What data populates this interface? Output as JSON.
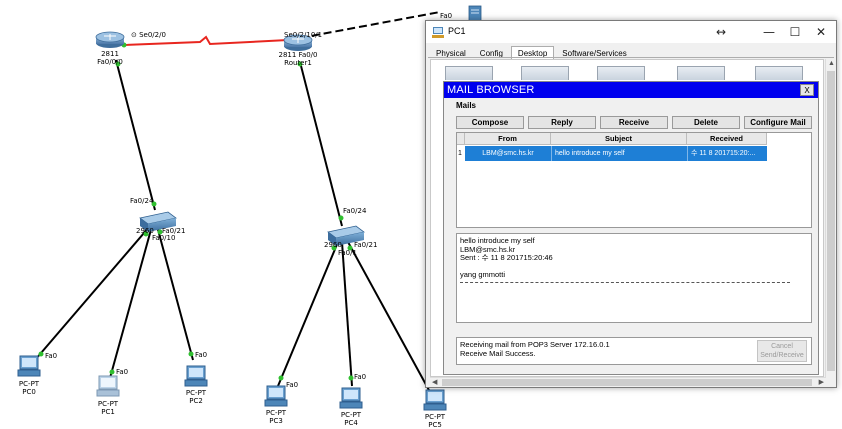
{
  "topology": {
    "router_2811": {
      "model": "2811",
      "port_label": "Fa0/0",
      "serial_label": "Se0/2/0"
    },
    "router1": {
      "model": "2811",
      "name": "Router1",
      "serial_label": "Se0/2/1",
      "port_label": "Fa0/0",
      "top_label": "Se0/2/10/1",
      "name_label": "Router1"
    },
    "switch_left": {
      "uplink_label": "Fa0/24",
      "port_a": "Fa0/21",
      "port_b": "Fa0/10",
      "name_fragment": "2960"
    },
    "switch_right": {
      "uplink_label": "Fa0/24",
      "port_a": "Fa0/21",
      "port_b": "Fa0/1",
      "name_fragment": "2960"
    },
    "pcs": [
      {
        "type": "PC-PT",
        "name": "PC0",
        "port": "Fa0"
      },
      {
        "type": "PC-PT",
        "name": "PC1",
        "port": "Fa0"
      },
      {
        "type": "PC-PT",
        "name": "PC2",
        "port": "Fa0"
      },
      {
        "type": "PC-PT",
        "name": "PC3",
        "port": "Fa0"
      },
      {
        "type": "PC-PT",
        "name": "PC4",
        "port": "Fa0"
      },
      {
        "type": "PC-PT",
        "name": "PC5",
        "port": ""
      }
    ],
    "server_port": "Fa0"
  },
  "window": {
    "title": "PC1",
    "resize_glyph": "↔",
    "minimize": "—",
    "maximize": "☐",
    "close": "✕",
    "tabs": [
      "Physical",
      "Config",
      "Desktop",
      "Software/Services"
    ],
    "active_tab": "Desktop"
  },
  "mail_browser": {
    "title": "MAIL BROWSER",
    "close": "X",
    "section_label": "Mails",
    "buttons": [
      "Compose",
      "Reply",
      "Receive",
      "Delete",
      "Configure Mail"
    ],
    "columns": [
      "From",
      "Subject",
      "Received"
    ],
    "rows": [
      {
        "index": "1",
        "from": "LBM@smc.hs.kr",
        "subject": "hello introduce my self",
        "received": "수 11 8 201715:20:..."
      }
    ],
    "preview_lines": [
      "hello introduce my self",
      "LBM@smc.hs.kr",
      "Sent : 수 11 8 201715:20:46",
      "",
      "yang gmmotti"
    ],
    "status_lines": [
      "Receiving mail from POP3 Server 172.16.0.1",
      "Receive Mail Success."
    ],
    "cancel_button": [
      "Cancel",
      "Send/Receive"
    ]
  },
  "colors": {
    "selected_row": "#1e7fd6",
    "mail_title_bar": "#0000ee",
    "serial_link": "#e8261f",
    "link_ok_dot": "#2fbf2f"
  }
}
